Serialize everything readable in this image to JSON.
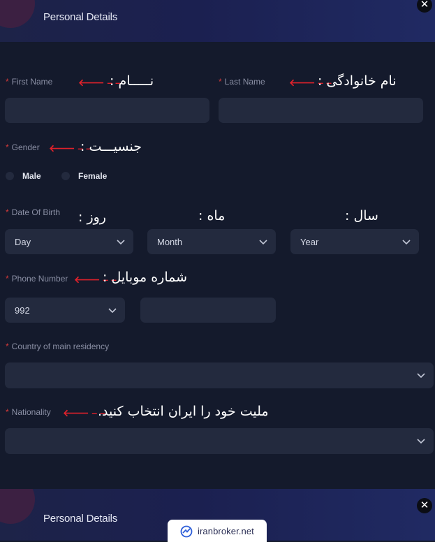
{
  "header_top": {
    "title": "Personal Details",
    "close_icon": "✕"
  },
  "fields": {
    "first_name": {
      "label": "First Name",
      "annotation": "نـــــام :"
    },
    "last_name": {
      "label": "Last Name",
      "annotation": "نام خانوادگی :"
    },
    "gender": {
      "label": "Gender",
      "annotation": "جنسیـــت :",
      "options": [
        "Male",
        "Female"
      ]
    },
    "dob": {
      "label": "Date Of Birth",
      "day": {
        "value": "Day",
        "annotation": "روز :"
      },
      "month": {
        "value": "Month",
        "annotation": "ماه :"
      },
      "year": {
        "value": "Year",
        "annotation": "سال :"
      }
    },
    "phone": {
      "label": "Phone Number",
      "annotation": "شماره موبایل :",
      "code": "992"
    },
    "country": {
      "label": "Country of main residency"
    },
    "nationality": {
      "label": "Nationality",
      "annotation": "ملیت خود را ایران انتخاب کنید."
    }
  },
  "arrow_glyph": "🡐 – –",
  "header_bottom": {
    "title": "Personal Details",
    "close_icon": "✕"
  },
  "watermark": {
    "text": "iranbroker.net"
  },
  "colors": {
    "background": "#141a2c",
    "field": "#232a3e",
    "required_star": "#d43a3a",
    "annotation_arrow": "#e0212b"
  }
}
